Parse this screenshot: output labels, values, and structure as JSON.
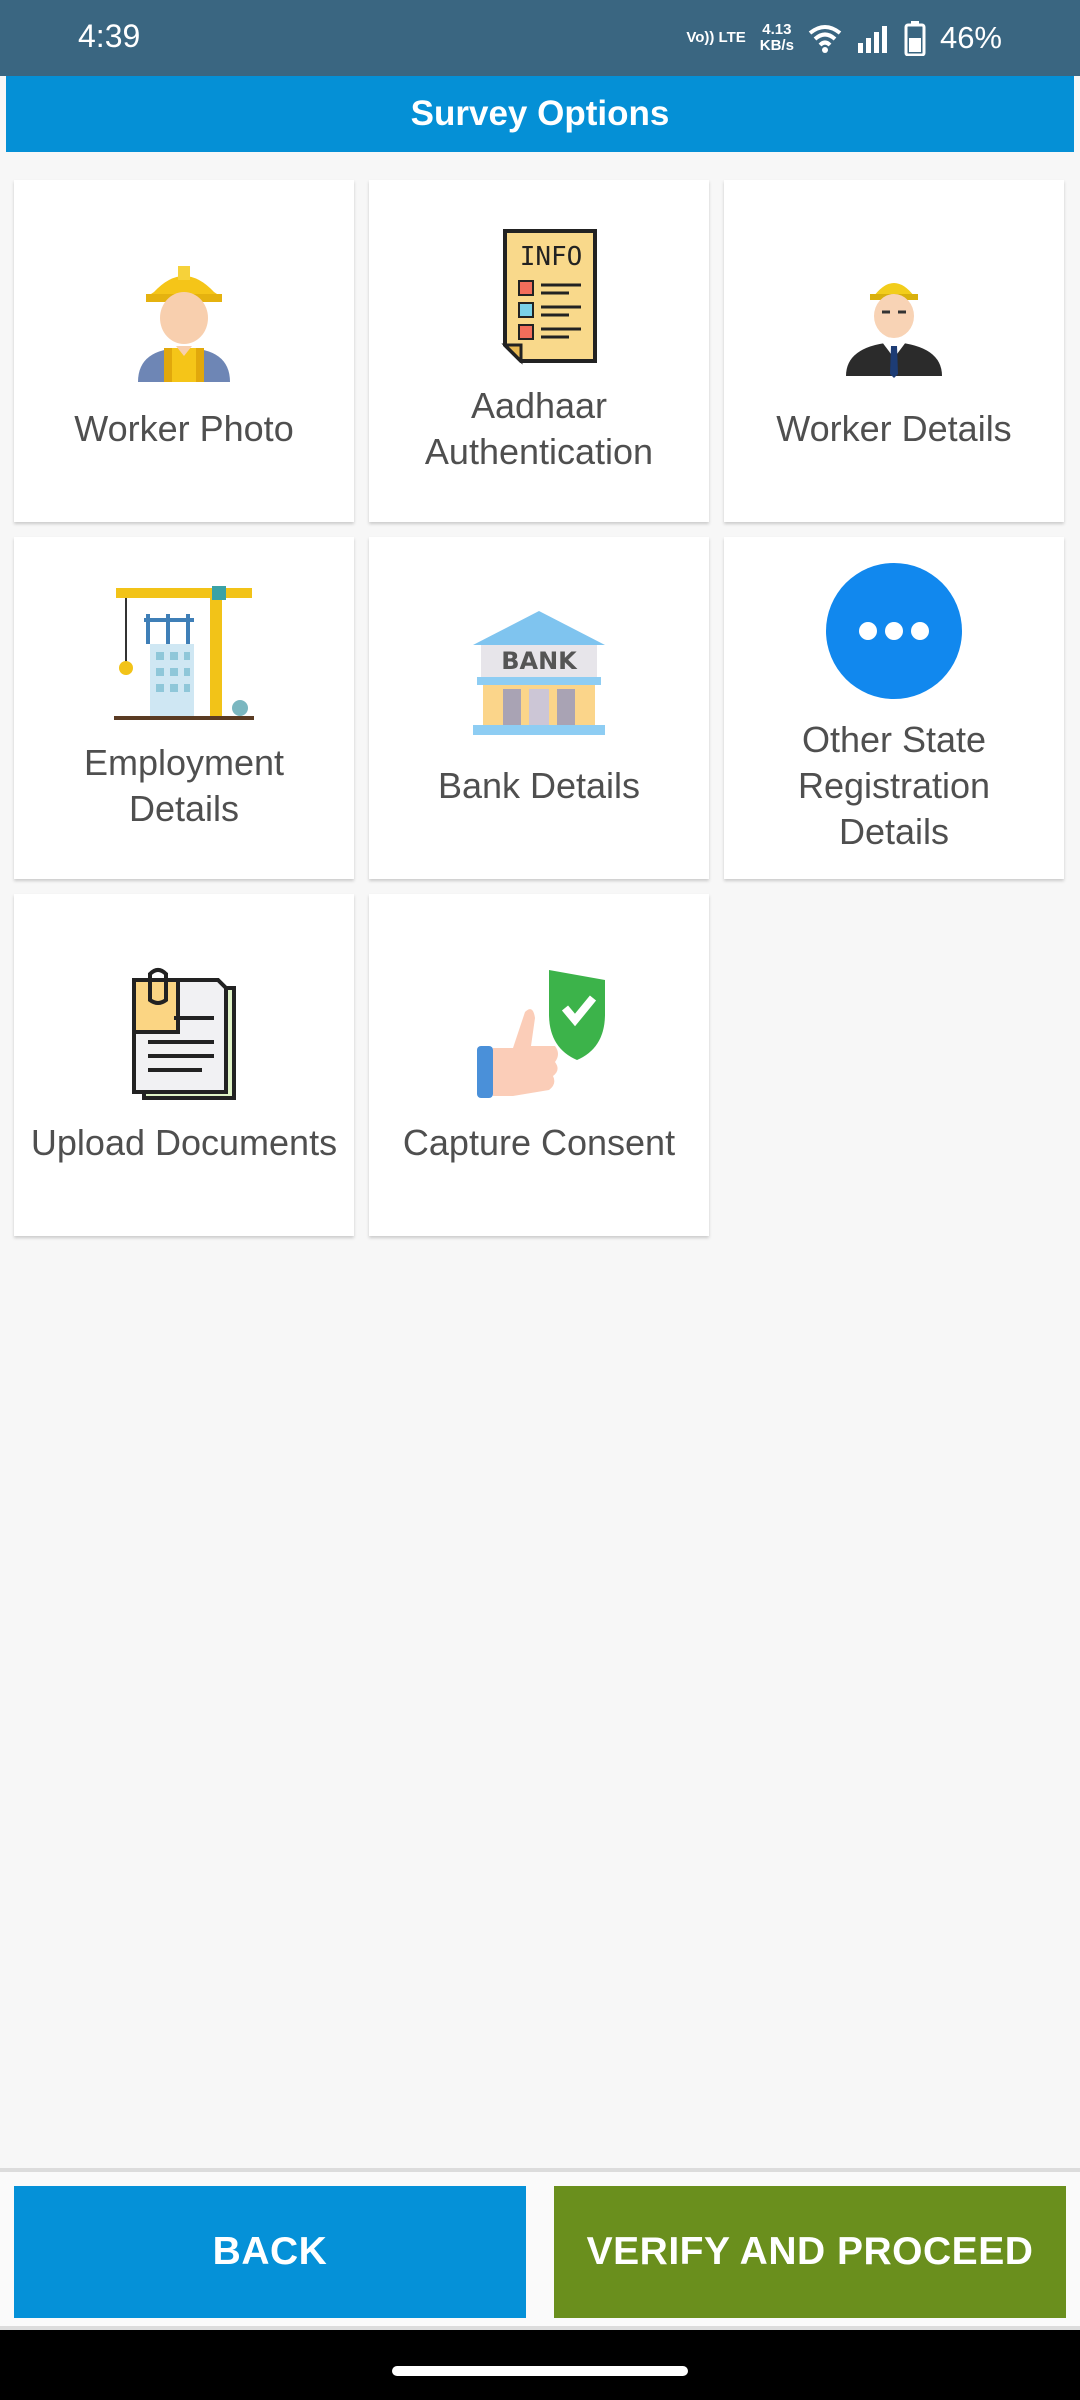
{
  "status_bar": {
    "time": "4:39",
    "network": "Vo)) LTE",
    "speed_value": "4.13",
    "speed_unit": "KB/s",
    "battery": "46%"
  },
  "header": {
    "title": "Survey Options"
  },
  "options": [
    {
      "label": "Worker Photo",
      "icon": "worker-photo-icon"
    },
    {
      "label": "Aadhaar Authentication",
      "icon": "info-document-icon"
    },
    {
      "label": "Worker Details",
      "icon": "worker-details-icon"
    },
    {
      "label": "Employment Details",
      "icon": "construction-crane-icon"
    },
    {
      "label": "Bank Details",
      "icon": "bank-icon"
    },
    {
      "label": "Other State Registration Details",
      "icon": "more-icon"
    },
    {
      "label": "Upload Documents",
      "icon": "documents-icon"
    },
    {
      "label": "Capture Consent",
      "icon": "consent-icon"
    }
  ],
  "footer": {
    "back_label": "BACK",
    "verify_label": "VERIFY AND PROCEED"
  },
  "colors": {
    "status_bar": "#3a6681",
    "header": "#0590d6",
    "back": "#0591d8",
    "verify": "#6a8f1d",
    "more_icon": "#1188ee"
  }
}
